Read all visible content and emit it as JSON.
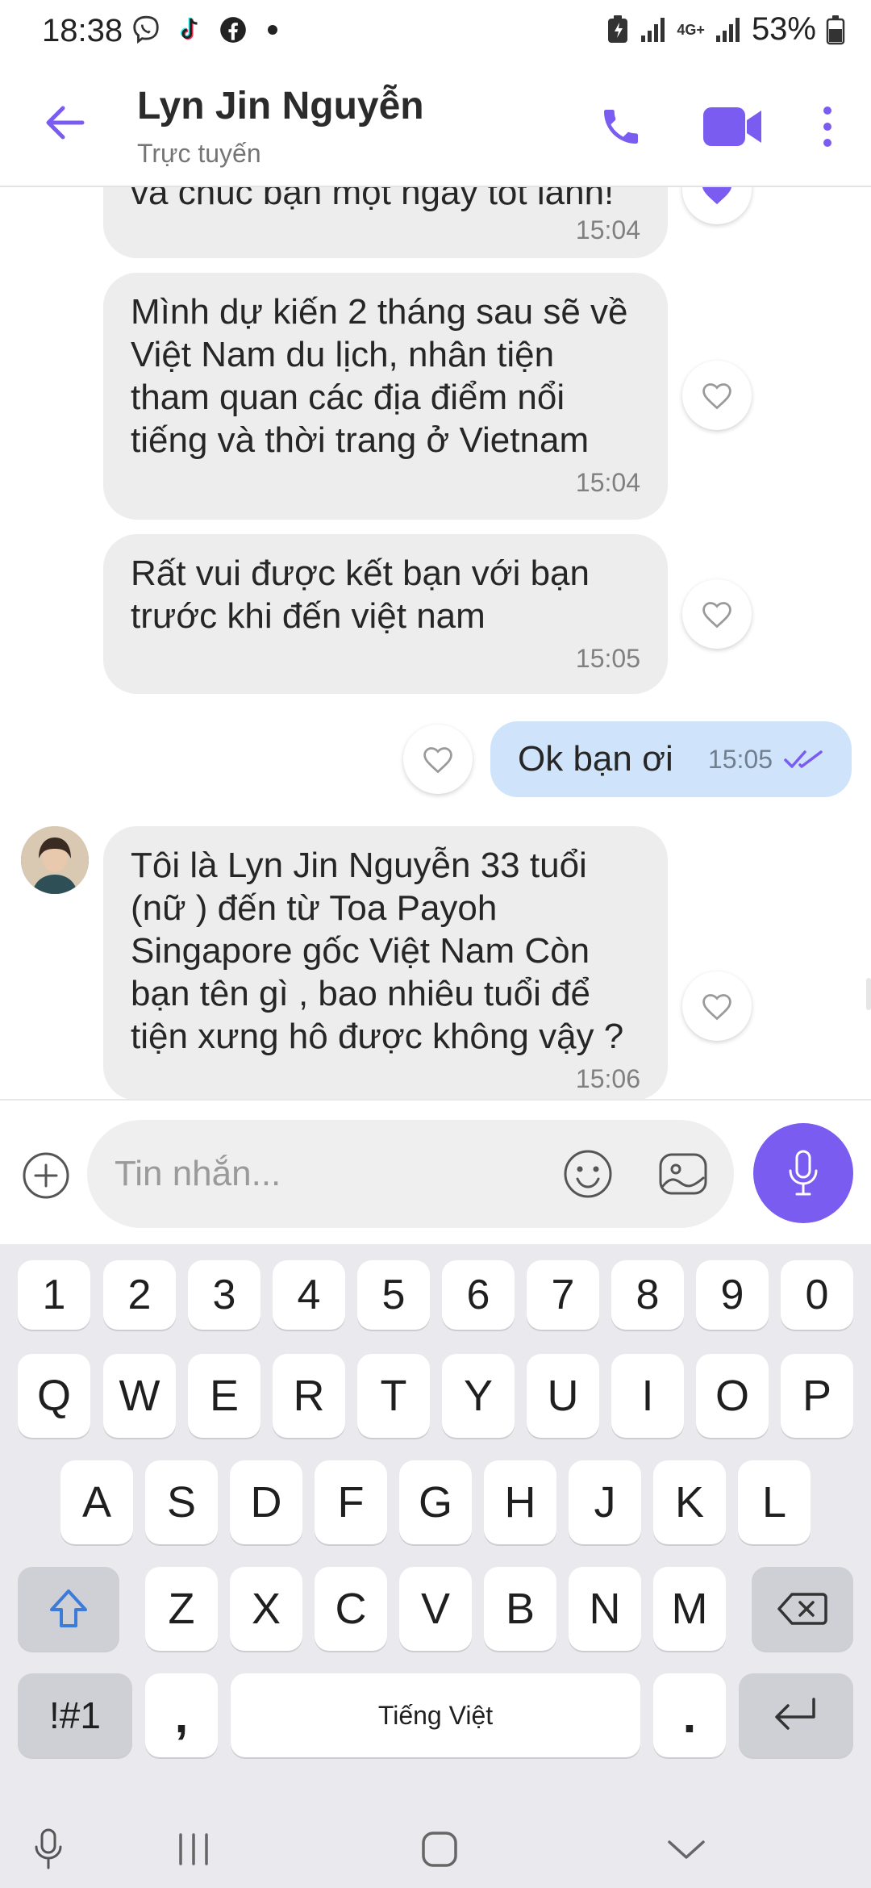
{
  "status_bar": {
    "time": "18:38",
    "network": "4G+",
    "battery": "53%"
  },
  "header": {
    "contact_name": "Lyn Jin Nguyễn",
    "status": "Trực tuyến"
  },
  "messages": [
    {
      "direction": "incoming",
      "text": "và chúc bạn một ngày tốt lành!",
      "time": "15:04"
    },
    {
      "direction": "incoming",
      "text": "Mình dự kiến 2 tháng sau sẽ về Việt Nam du lịch, nhân tiện tham quan các địa điểm nổi tiếng và thời trang ở Vietnam",
      "time": "15:04"
    },
    {
      "direction": "incoming",
      "text": "Rất vui được kết bạn với bạn trước khi đến việt nam",
      "time": "15:05"
    },
    {
      "direction": "outgoing",
      "text": "Ok bạn ơi",
      "time": "15:05",
      "status": "read"
    },
    {
      "direction": "incoming",
      "text": "Tôi là Lyn Jin Nguyễn 33 tuổi (nữ ) đến từ Toa Payoh Singapore gốc Việt Nam Còn bạn tên gì , bao nhiêu tuổi để tiện xưng hô được không vậy ?",
      "time": "15:06"
    }
  ],
  "composer": {
    "placeholder": "Tin nhắn..."
  },
  "keyboard": {
    "row_numbers": [
      "1",
      "2",
      "3",
      "4",
      "5",
      "6",
      "7",
      "8",
      "9",
      "0"
    ],
    "row_1": [
      "Q",
      "W",
      "E",
      "R",
      "T",
      "Y",
      "U",
      "I",
      "O",
      "P"
    ],
    "row_2": [
      "A",
      "S",
      "D",
      "F",
      "G",
      "H",
      "J",
      "K",
      "L"
    ],
    "row_3": [
      "Z",
      "X",
      "C",
      "V",
      "B",
      "N",
      "M"
    ],
    "symbols_key": "!#1",
    "comma_key": ",",
    "space_label": "Tiếng Việt",
    "period_key": "."
  },
  "colors": {
    "accent": "#7b5cf0",
    "incoming_bubble": "#ededed",
    "outgoing_bubble": "#cfe4fb",
    "keyboard_bg": "#e9e9ee"
  }
}
